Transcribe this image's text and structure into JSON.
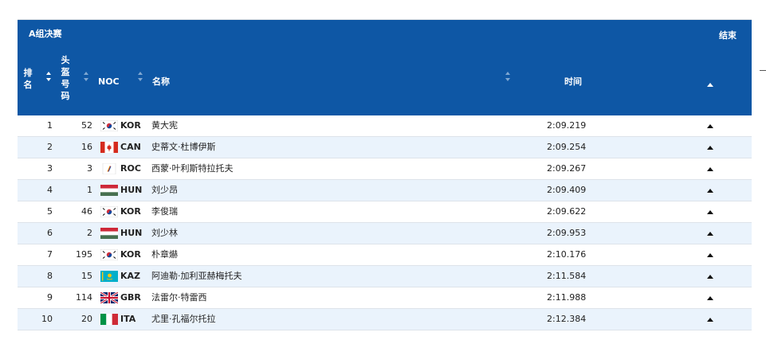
{
  "header": {
    "phase": "A组决赛",
    "status": "结束",
    "columns": {
      "rank": [
        "排",
        "名"
      ],
      "bib": [
        "头",
        "盔",
        "号",
        "码"
      ],
      "noc": "NOC",
      "name": "名称",
      "time": "时间"
    }
  },
  "rows": [
    {
      "rank": "1",
      "bib": "52",
      "noc": "KOR",
      "flag": "korea",
      "name": "黄大宪",
      "time": "2:09.219"
    },
    {
      "rank": "2",
      "bib": "16",
      "noc": "CAN",
      "flag": "canada",
      "name": "史蒂文·杜博伊斯",
      "time": "2:09.254"
    },
    {
      "rank": "3",
      "bib": "3",
      "noc": "ROC",
      "flag": "roc",
      "name": "西蒙·叶利斯特拉托夫",
      "time": "2:09.267"
    },
    {
      "rank": "4",
      "bib": "1",
      "noc": "HUN",
      "flag": "hungary",
      "name": "刘少昂",
      "time": "2:09.409"
    },
    {
      "rank": "5",
      "bib": "46",
      "noc": "KOR",
      "flag": "korea",
      "name": "李俊瑞",
      "time": "2:09.622"
    },
    {
      "rank": "6",
      "bib": "2",
      "noc": "HUN",
      "flag": "hungary",
      "name": "刘少林",
      "time": "2:09.953"
    },
    {
      "rank": "7",
      "bib": "195",
      "noc": "KOR",
      "flag": "korea",
      "name": "朴章爀",
      "time": "2:10.176"
    },
    {
      "rank": "8",
      "bib": "15",
      "noc": "KAZ",
      "flag": "kazakhstan",
      "name": "阿迪勒·加利亚赫梅托夫",
      "time": "2:11.584"
    },
    {
      "rank": "9",
      "bib": "114",
      "noc": "GBR",
      "flag": "uk",
      "name": "法雷尔·特雷西",
      "time": "2:11.988"
    },
    {
      "rank": "10",
      "bib": "20",
      "noc": "ITA",
      "flag": "italy",
      "name": "尤里·孔福尔托拉",
      "time": "2:12.384"
    }
  ],
  "colors": {
    "header_bg": "#0e57a5",
    "row_alt": "#eaf3fc"
  },
  "icons": {
    "expand": "chevron-up-icon",
    "sort": "sort-arrows-icon"
  }
}
